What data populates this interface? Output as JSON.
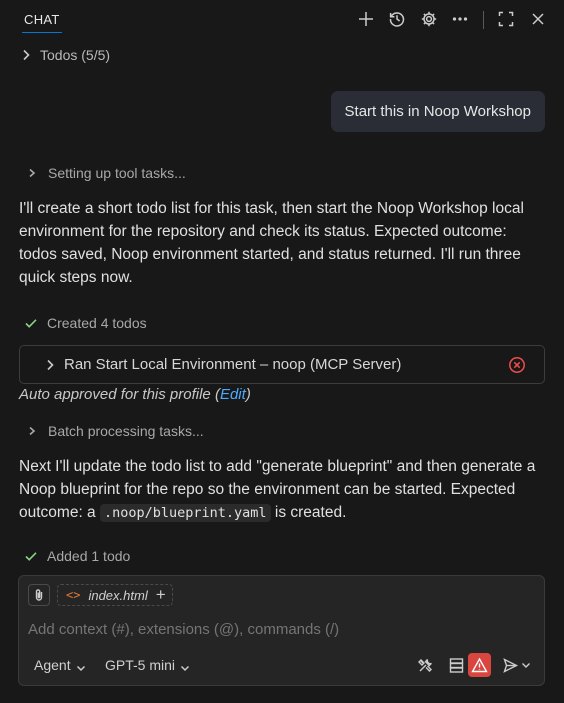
{
  "header": {
    "tab_label": "CHAT",
    "icons": [
      "plus-icon",
      "history-icon",
      "gear-icon",
      "more-icon",
      "maximize-icon",
      "close-icon"
    ]
  },
  "todos": {
    "label": "Todos (5/5)"
  },
  "user_message": "Start this in Noop Workshop",
  "thinking_1": "Setting up tool tasks...",
  "para_1": "I'll create a short todo list for this task, then start the Noop Workshop local environment for the repository and check its status. Expected outcome: todos saved, Noop environment started, and status returned. I'll run three quick steps now.",
  "created_todos": "Created 4 todos",
  "tool_call": {
    "label": "Ran Start Local Environment – noop (MCP Server)",
    "status_icon": "error-circle-icon"
  },
  "auto_approved": {
    "prefix": "Auto approved for this profile (",
    "link": "Edit",
    "suffix": ")"
  },
  "thinking_2": "Batch processing tasks...",
  "para_2": {
    "before": "Next I'll update the todo list to add \"generate blueprint\" and then generate a Noop blueprint for the repo so the environment can be started. Expected outcome: a ",
    "code": ".noop/blueprint.yaml",
    "after": " is created."
  },
  "added_todo": "Added 1 todo",
  "composer": {
    "file_chip": "index.html",
    "placeholder": "Add context (#), extensions (@), commands (/)",
    "mode": "Agent",
    "model": "GPT-5 mini"
  },
  "colors": {
    "background": "#181818",
    "accent": "#0078d4",
    "link": "#4daafc",
    "success": "#89d185",
    "error": "#f14c4c",
    "warning_button": "#d9453f"
  }
}
